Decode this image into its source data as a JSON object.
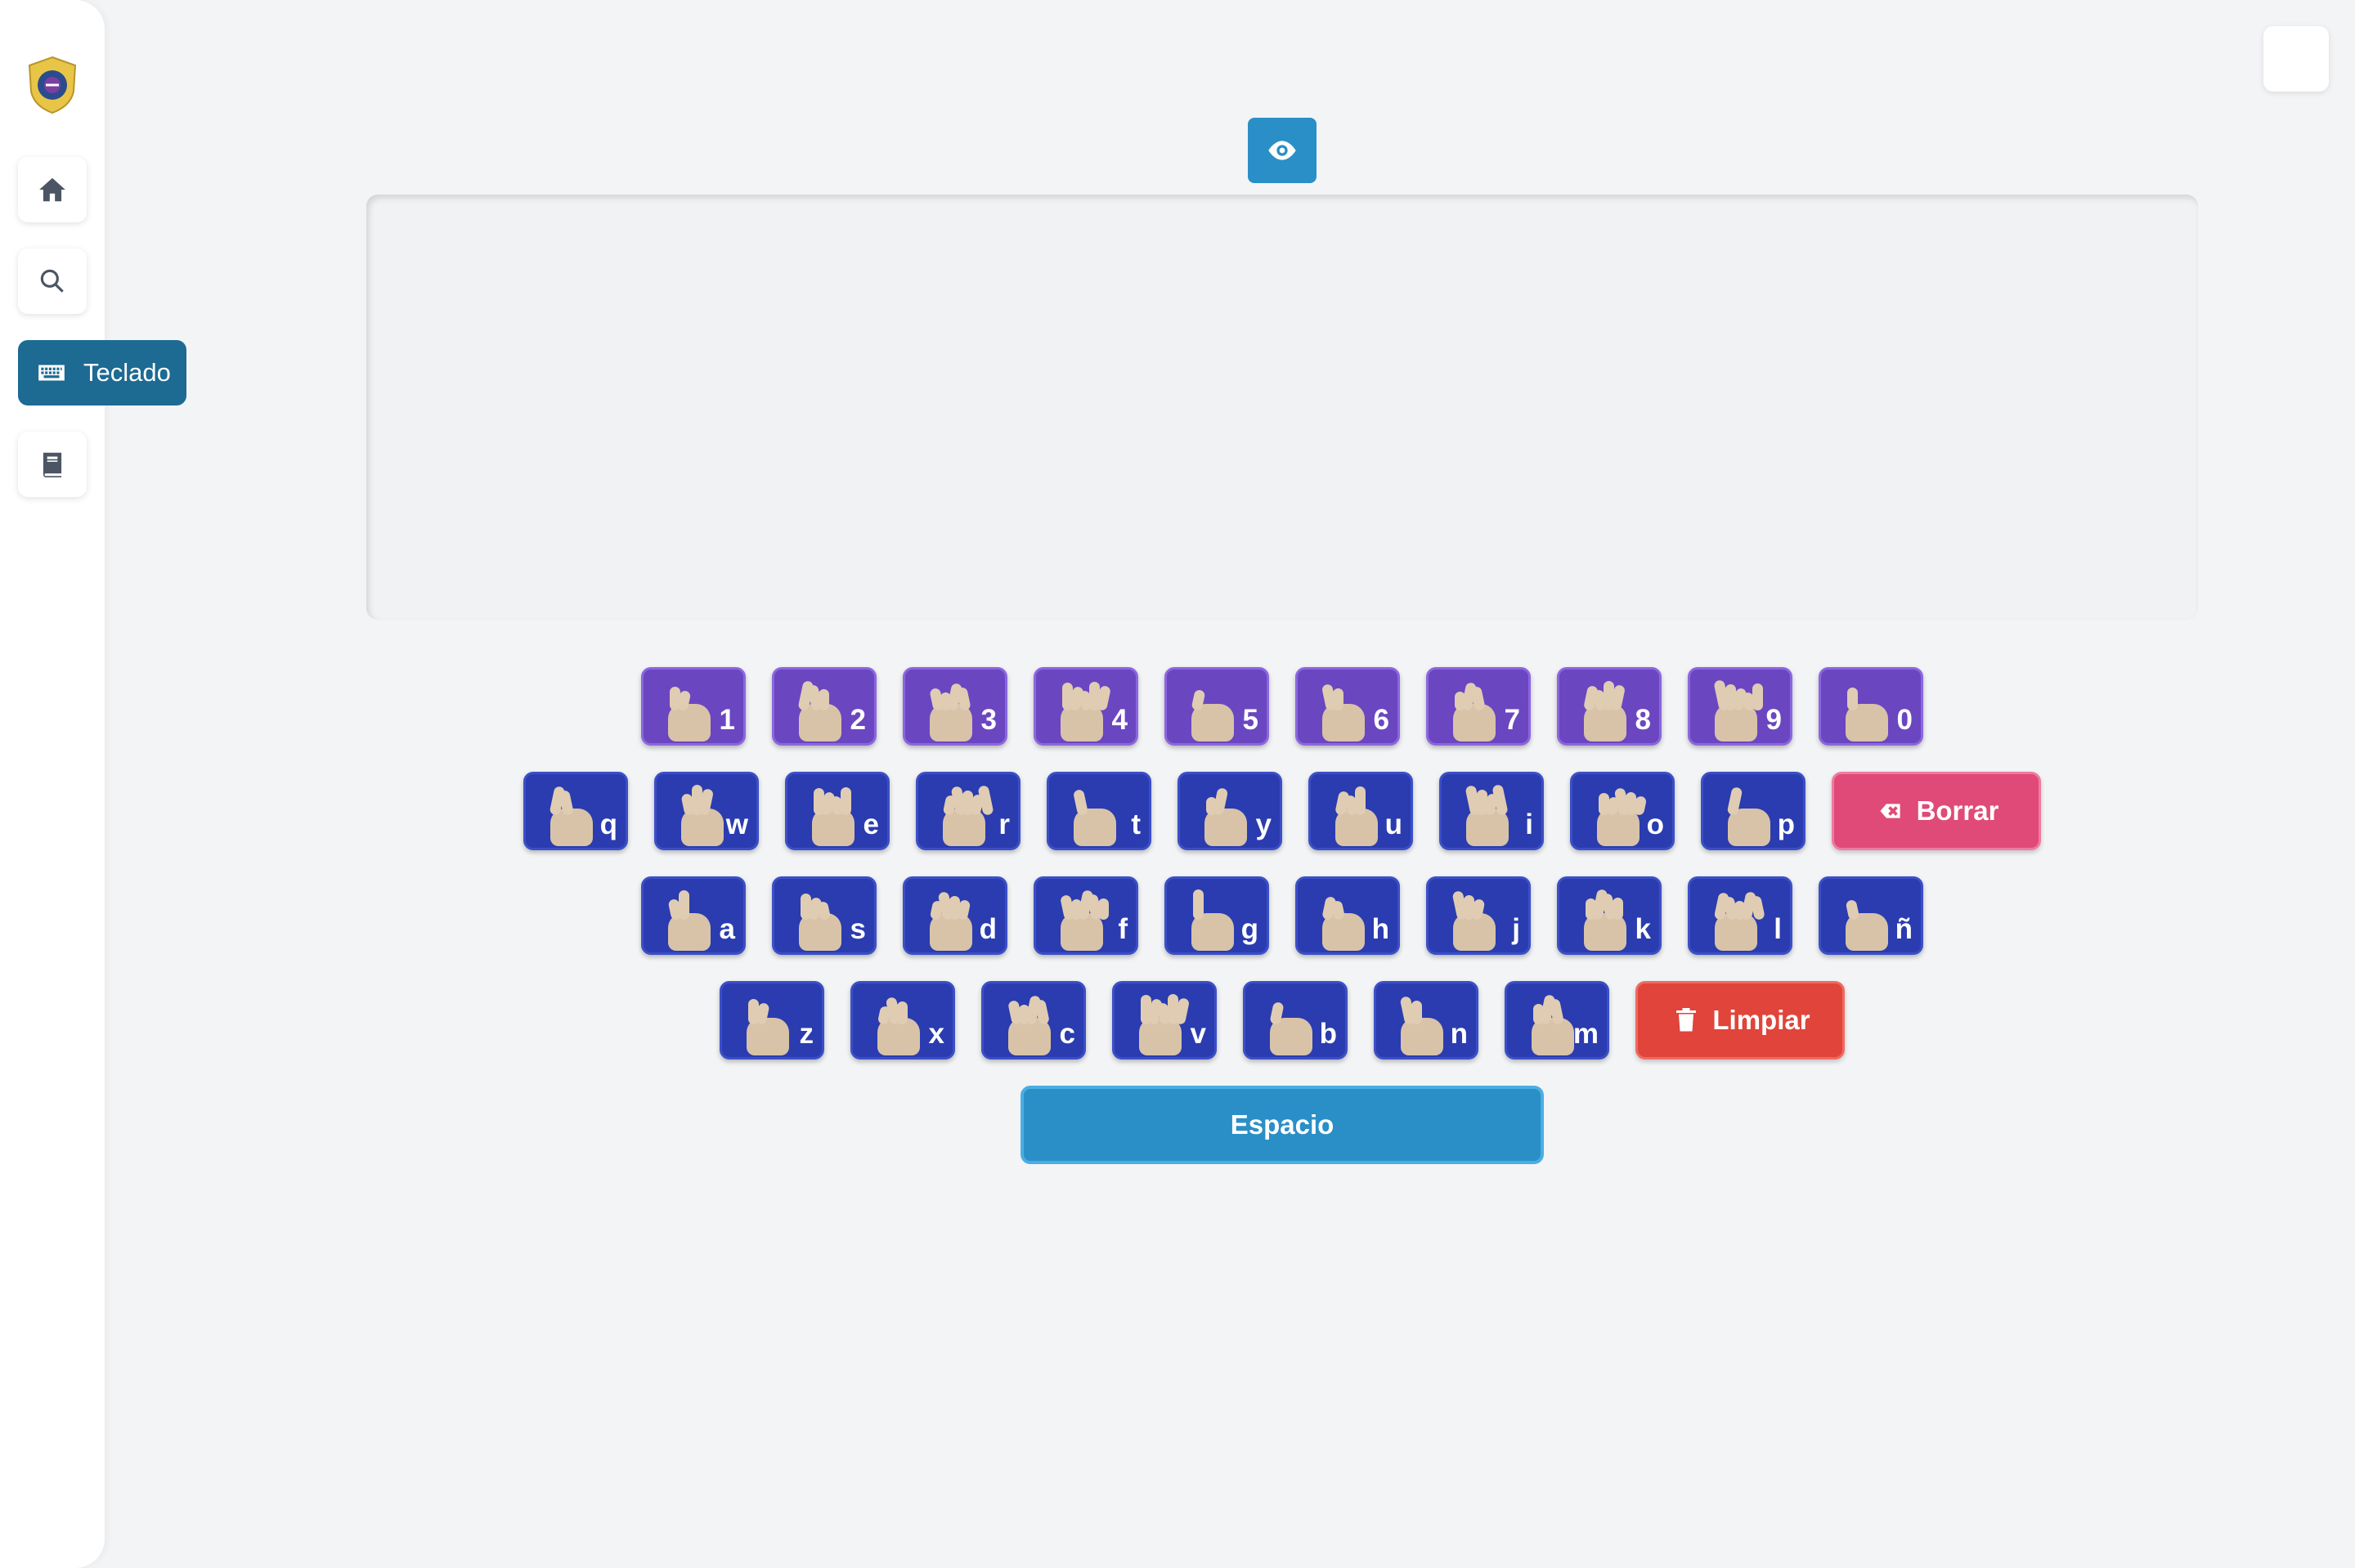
{
  "sidebar": {
    "logo_icon": "police-badge-logo",
    "items": [
      {
        "icon": "home-icon"
      },
      {
        "icon": "search-icon"
      },
      {
        "icon": "keyboard-icon",
        "label": "Teclado",
        "active": true
      },
      {
        "icon": "book-icon"
      }
    ]
  },
  "theme_toggle": {
    "icon": "moon-icon"
  },
  "toolbar": {
    "icon": "eye-icon"
  },
  "output_text": "",
  "keyboard": {
    "row1": [
      "1",
      "2",
      "3",
      "4",
      "5",
      "6",
      "7",
      "8",
      "9",
      "0"
    ],
    "row2": [
      "q",
      "w",
      "e",
      "r",
      "t",
      "y",
      "u",
      "i",
      "o",
      "p"
    ],
    "row3": [
      "a",
      "s",
      "d",
      "f",
      "g",
      "h",
      "j",
      "k",
      "l",
      "ñ"
    ],
    "row4": [
      "z",
      "x",
      "c",
      "v",
      "b",
      "n",
      "m"
    ],
    "borrar_label": "Borrar",
    "limpiar_label": "Limpiar",
    "espacio_label": "Espacio"
  },
  "colors": {
    "number_key": "#6b46c1",
    "letter_key": "#2a3caf",
    "active_nav": "#1d6a93",
    "accent": "#2a8fc7",
    "borrar": "#e04a78",
    "limpiar": "#e0443a"
  }
}
